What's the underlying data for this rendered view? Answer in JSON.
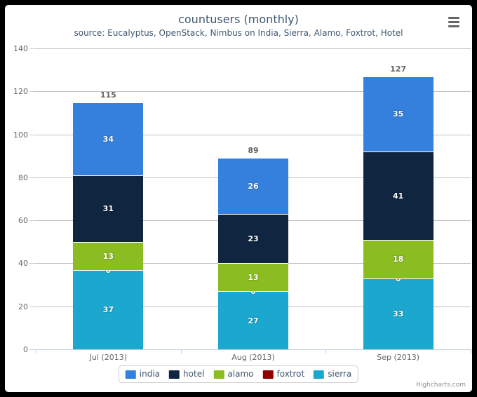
{
  "chart": {
    "title": "countusers (monthly)",
    "subtitle": "source: Eucalyptus, OpenStack, Nimbus on India, Sierra, Alamo, Foxtrot, Hotel",
    "credits": "Highcharts.com",
    "export_menu_icon": "hamburger-menu-icon"
  },
  "chart_data": {
    "type": "bar",
    "stacked": true,
    "title": "countusers (monthly)",
    "subtitle": "source: Eucalyptus, OpenStack, Nimbus on India, Sierra, Alamo, Foxtrot, Hotel",
    "xlabel": "",
    "ylabel": "",
    "categories": [
      "Jul (2013)",
      "Aug (2013)",
      "Sep (2013)"
    ],
    "ylim": [
      0,
      140
    ],
    "yticks": [
      0,
      20,
      40,
      60,
      80,
      100,
      120,
      140
    ],
    "grid": true,
    "legend_position": "bottom",
    "stack_order_bottom_to_top": [
      "sierra",
      "foxtrot",
      "alamo",
      "hotel",
      "india"
    ],
    "series": [
      {
        "name": "india",
        "color": "#3480DC",
        "values": [
          34,
          26,
          35
        ]
      },
      {
        "name": "hotel",
        "color": "#10253F",
        "values": [
          31,
          23,
          41
        ]
      },
      {
        "name": "alamo",
        "color": "#8BBC21",
        "values": [
          13,
          13,
          18
        ]
      },
      {
        "name": "foxtrot",
        "color": "#910000",
        "values": [
          0,
          0,
          0
        ]
      },
      {
        "name": "sierra",
        "color": "#1CA8CE",
        "values": [
          37,
          27,
          33
        ]
      }
    ],
    "stack_totals": [
      115,
      89,
      127
    ]
  },
  "yaxis": {
    "labels": [
      "140",
      "120",
      "100",
      "80",
      "60",
      "40",
      "20",
      "0"
    ]
  },
  "xaxis": {
    "labels": [
      "Jul (2013)",
      "Aug (2013)",
      "Sep (2013)"
    ]
  },
  "legend": {
    "items": [
      {
        "label": "india",
        "color": "#3480DC"
      },
      {
        "label": "hotel",
        "color": "#10253F"
      },
      {
        "label": "alamo",
        "color": "#8BBC21"
      },
      {
        "label": "foxtrot",
        "color": "#910000"
      },
      {
        "label": "sierra",
        "color": "#1CA8CE"
      }
    ]
  }
}
